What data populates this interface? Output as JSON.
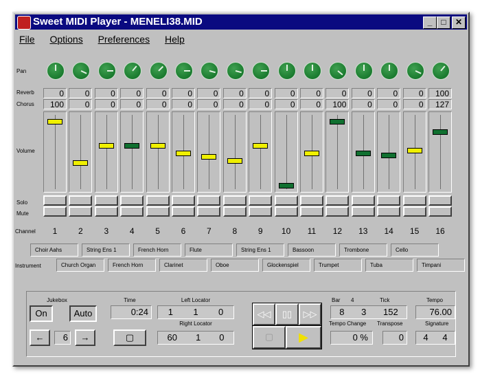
{
  "window": {
    "title": "Sweet MIDI Player - MENELI38.MID",
    "minimize": "_",
    "maximize": "□",
    "close": "✕"
  },
  "menu": [
    "File",
    "Options",
    "Preferences",
    "Help"
  ],
  "row_labels": {
    "pan": "Pan",
    "reverb": "Reverb",
    "chorus": "Chorus",
    "volume": "Volume",
    "solo": "Solo",
    "mute": "Mute",
    "channel": "Channel",
    "instrument": "Instrument"
  },
  "channels": [
    {
      "n": "1",
      "pan_angle": 0,
      "reverb": "0",
      "chorus": "100",
      "volume": 121,
      "color": "#f0f000"
    },
    {
      "n": "2",
      "pan_angle": 115,
      "reverb": "0",
      "chorus": "0",
      "volume": 46,
      "color": "#f0f000"
    },
    {
      "n": "3",
      "pan_angle": 90,
      "reverb": "0",
      "chorus": "0",
      "volume": 77,
      "color": "#f0f000"
    },
    {
      "n": "4",
      "pan_angle": 40,
      "reverb": "0",
      "chorus": "0",
      "volume": 77,
      "color": "#107030"
    },
    {
      "n": "5",
      "pan_angle": 45,
      "reverb": "0",
      "chorus": "0",
      "volume": 77,
      "color": "#f0f000"
    },
    {
      "n": "6",
      "pan_angle": 90,
      "reverb": "0",
      "chorus": "0",
      "volume": 63,
      "color": "#f0f000"
    },
    {
      "n": "7",
      "pan_angle": 105,
      "reverb": "0",
      "chorus": "0",
      "volume": 57,
      "color": "#f0f000"
    },
    {
      "n": "8",
      "pan_angle": 105,
      "reverb": "0",
      "chorus": "0",
      "volume": 50,
      "color": "#f0f000"
    },
    {
      "n": "9",
      "pan_angle": 90,
      "reverb": "0",
      "chorus": "0",
      "volume": 77,
      "color": "#f0f000"
    },
    {
      "n": "10",
      "pan_angle": 0,
      "reverb": "0",
      "chorus": "0",
      "volume": 5,
      "color": "#107030"
    },
    {
      "n": "11",
      "pan_angle": 0,
      "reverb": "0",
      "chorus": "0",
      "volume": 63,
      "color": "#f0f000"
    },
    {
      "n": "12",
      "pan_angle": 130,
      "reverb": "0",
      "chorus": "100",
      "volume": 121,
      "color": "#107030"
    },
    {
      "n": "13",
      "pan_angle": 0,
      "reverb": "0",
      "chorus": "0",
      "volume": 63,
      "color": "#107030"
    },
    {
      "n": "14",
      "pan_angle": 0,
      "reverb": "0",
      "chorus": "0",
      "volume": 60,
      "color": "#107030"
    },
    {
      "n": "15",
      "pan_angle": 115,
      "reverb": "0",
      "chorus": "0",
      "volume": 68,
      "color": "#f0f000"
    },
    {
      "n": "16",
      "pan_angle": 40,
      "reverb": "100",
      "chorus": "127",
      "volume": 102,
      "color": "#107030"
    }
  ],
  "instruments_top": [
    "Choir Aahs",
    "String Ens 1",
    "French Horn",
    "Flute",
    "String Ens 1",
    "Bassoon",
    "Trombone",
    "Cello"
  ],
  "instruments_bottom": [
    "Church Organ",
    "French Horn",
    "Clarinet",
    "Oboe",
    "Glockenspiel",
    "Trumpet",
    "Tuba",
    "Timpani"
  ],
  "transport": {
    "jukebox_label": "Jukebox",
    "on": "On",
    "auto": "Auto",
    "prev": "←",
    "next": "→",
    "song_number": "6",
    "time_label": "Time",
    "time": "0:24",
    "left_locator_label": "Left Locator",
    "left_locator": [
      "1",
      "1",
      "0"
    ],
    "right_locator_label": "Right Locator",
    "right_locator": [
      "60",
      "1",
      "0"
    ],
    "rewind": "◁◁",
    "pause": "▯▯",
    "forward": "▷▷",
    "bar_label": "Bar",
    "bar_beats": "4",
    "tick_label": "Tick",
    "position": [
      "8",
      "3",
      "152"
    ],
    "tempo_label": "Tempo",
    "tempo": "76.00",
    "tempo_change_label": "Tempo Change",
    "tempo_change": "0 %",
    "transpose_label": "Transpose",
    "transpose": "0",
    "signature_label": "Signature",
    "signature": [
      "4",
      "4"
    ]
  }
}
